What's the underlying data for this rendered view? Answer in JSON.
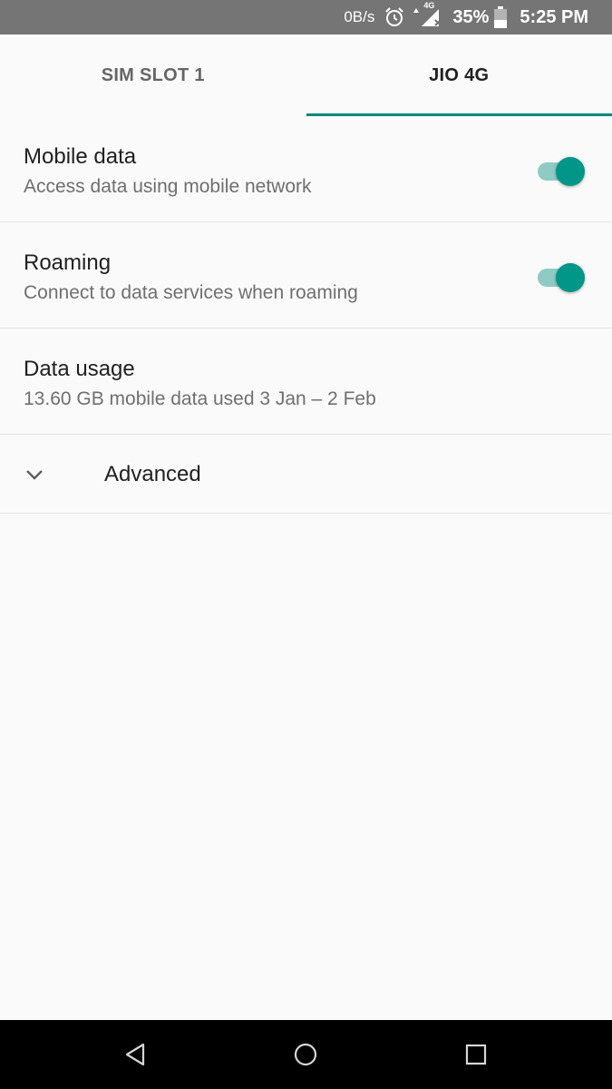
{
  "status_bar": {
    "net_speed": "0B/s",
    "network_type": "4G",
    "battery_percent": "35%",
    "time": "5:25 PM",
    "icons": [
      "alarm-icon",
      "signal-icon",
      "battery-icon"
    ]
  },
  "tabs": [
    {
      "label": "SIM SLOT 1",
      "selected": false
    },
    {
      "label": "JIO 4G",
      "selected": true
    }
  ],
  "settings": {
    "mobile_data": {
      "title": "Mobile data",
      "summary": "Access data using mobile network",
      "enabled": true
    },
    "roaming": {
      "title": "Roaming",
      "summary": "Connect to data services when roaming",
      "enabled": true
    },
    "data_usage": {
      "title": "Data usage",
      "summary": "13.60 GB mobile data used 3 Jan – 2 Feb"
    },
    "advanced": {
      "label": "Advanced",
      "icon": "chevron-down-icon"
    }
  },
  "nav_bar": {
    "icons": [
      "back-icon",
      "home-icon",
      "recents-icon"
    ]
  },
  "colors": {
    "accent": "#009688",
    "status_bar": "#757575",
    "background": "#fafafa"
  }
}
